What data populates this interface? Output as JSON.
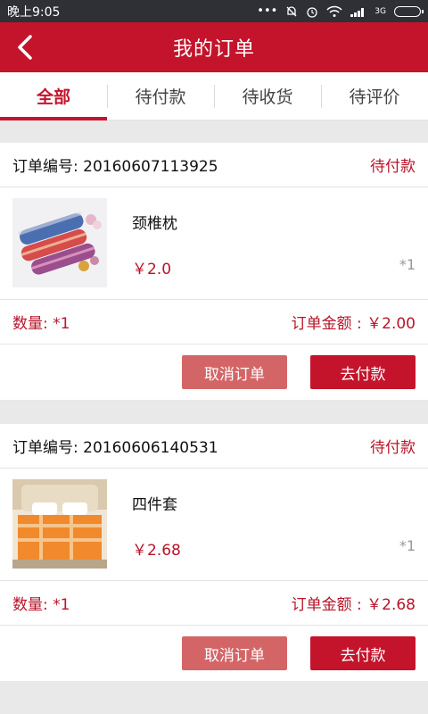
{
  "status_bar": {
    "time": "晚上9:05",
    "dots": "•••",
    "network": "3G"
  },
  "header": {
    "title": "我的订单",
    "back_icon": "back-arrow-icon"
  },
  "tabs": [
    {
      "label": "全部",
      "active": true
    },
    {
      "label": "待付款",
      "active": false
    },
    {
      "label": "待收货",
      "active": false
    },
    {
      "label": "待评价",
      "active": false
    }
  ],
  "orders": [
    {
      "number": "订单编号: 20160607113925",
      "status": "待付款",
      "item": {
        "name": "颈椎枕",
        "price": "￥2.0",
        "qty": "*1",
        "image": "pillow-image"
      },
      "quantity": "数量: *1",
      "amount": "订单金额 : ￥2.00",
      "cancel_label": "取消订单",
      "pay_label": "去付款"
    },
    {
      "number": "订单编号: 20160606140531",
      "status": "待付款",
      "item": {
        "name": "四件套",
        "price": "￥2.68",
        "qty": "*1",
        "image": "bedding-image"
      },
      "quantity": "数量: *1",
      "amount": "订单金额 : ￥2.68",
      "cancel_label": "取消订单",
      "pay_label": "去付款"
    }
  ],
  "colors": {
    "brand": "#c4142c",
    "cancel": "#d46567",
    "statusbar": "#2e3035"
  }
}
